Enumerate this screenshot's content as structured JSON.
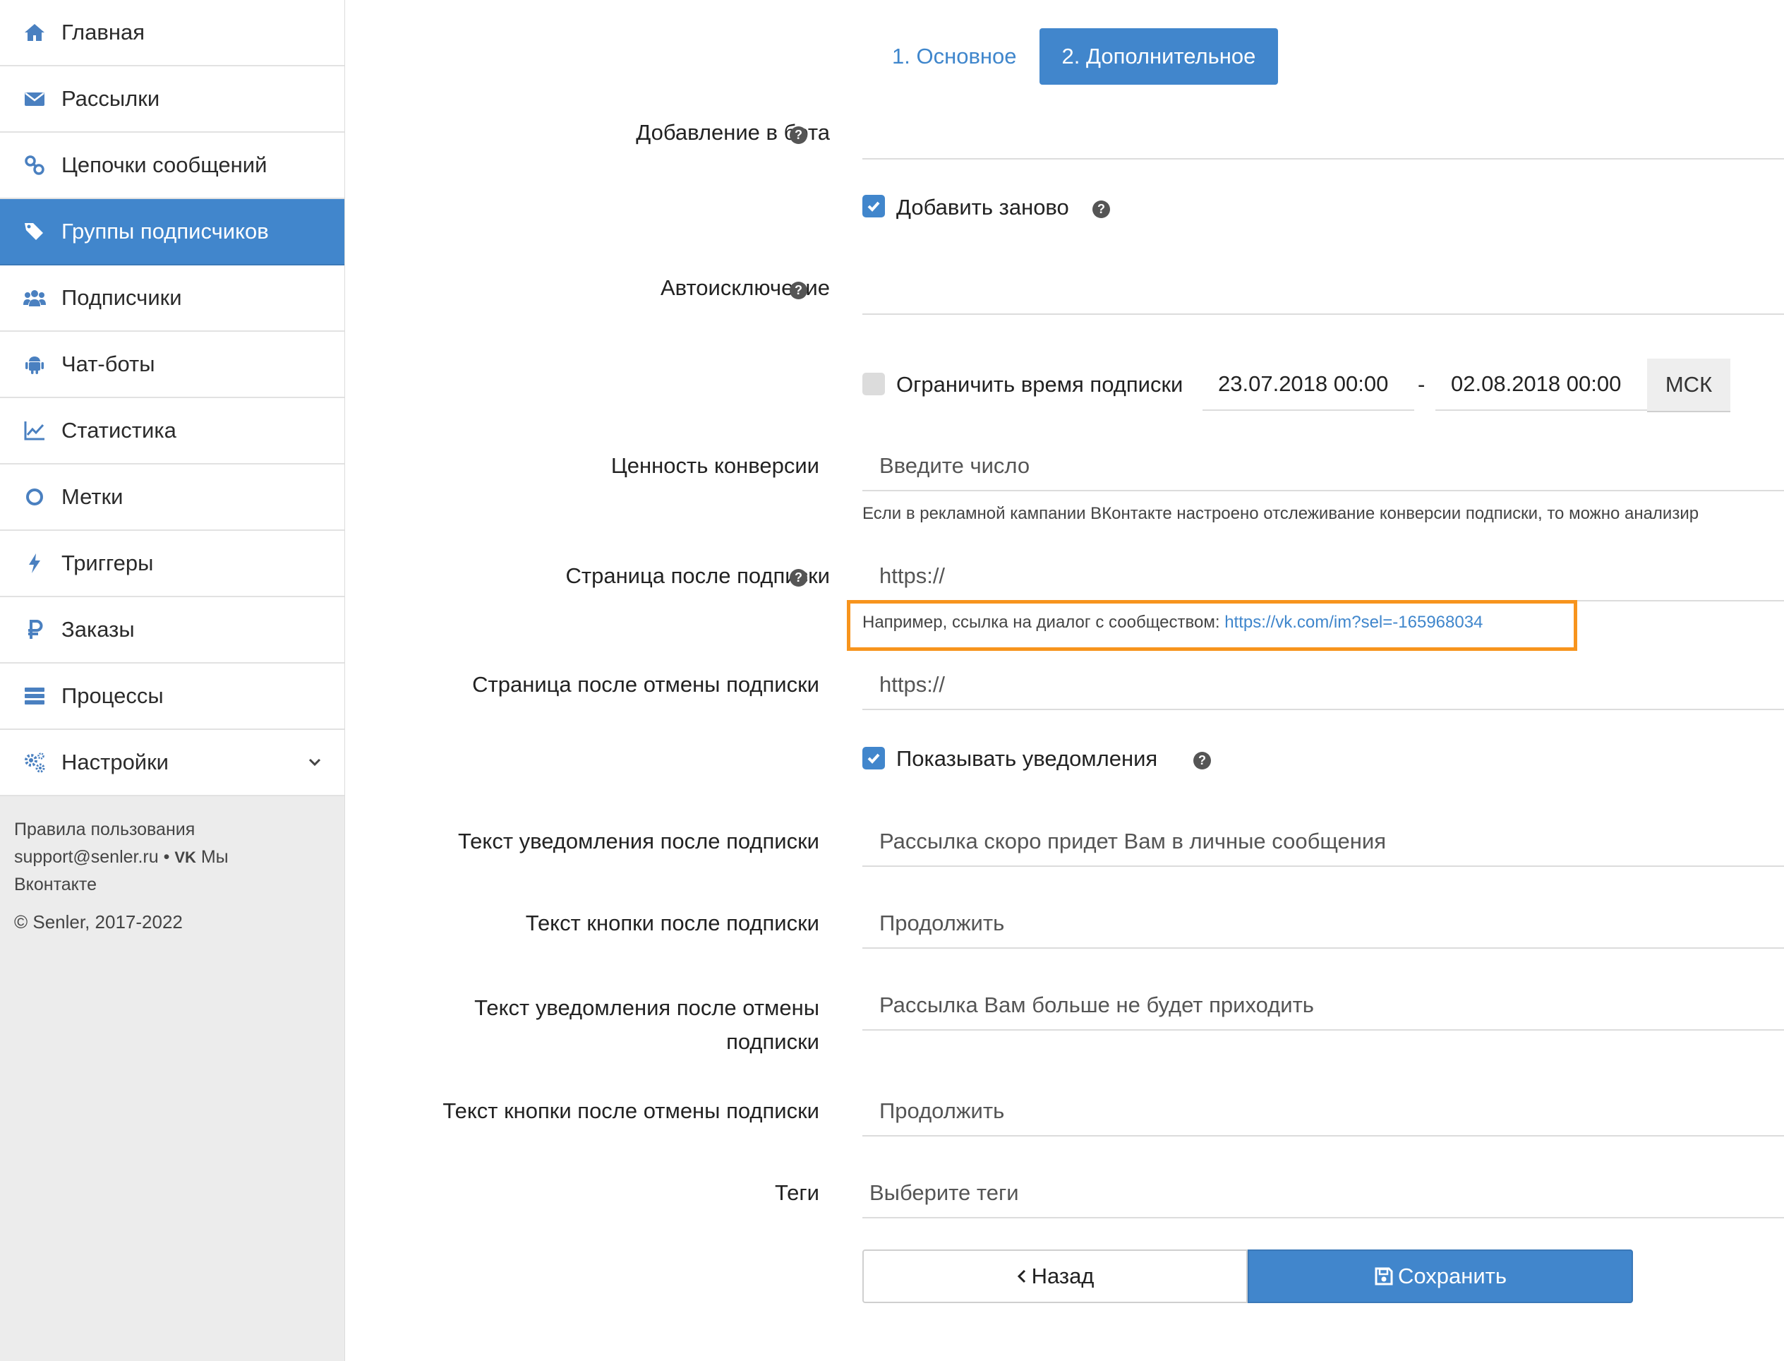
{
  "sidebar": {
    "items": [
      {
        "label": "Главная",
        "icon": "home-icon"
      },
      {
        "label": "Рассылки",
        "icon": "envelope-icon"
      },
      {
        "label": "Цепочки сообщений",
        "icon": "link-icon"
      },
      {
        "label": "Группы подписчиков",
        "icon": "tags-icon",
        "active": true
      },
      {
        "label": "Подписчики",
        "icon": "users-icon"
      },
      {
        "label": "Чат-боты",
        "icon": "android-icon"
      },
      {
        "label": "Статистика",
        "icon": "line-chart-icon"
      },
      {
        "label": "Метки",
        "icon": "circle-icon"
      },
      {
        "label": "Триггеры",
        "icon": "bolt-icon"
      },
      {
        "label": "Заказы",
        "icon": "ruble-icon"
      },
      {
        "label": "Процессы",
        "icon": "server-icon"
      },
      {
        "label": "Настройки",
        "icon": "gears-icon"
      }
    ],
    "footer": {
      "terms": "Правила пользования",
      "support": "support@senler.ru",
      "bullet": "•",
      "vk_logo": "VK",
      "vk_text": "Мы",
      "vk_text2": "Вконтакте",
      "copyright": "© Senler, 2017-2022"
    }
  },
  "tabs": {
    "basic": "1. Основное",
    "extra": "2. Дополнительное"
  },
  "form": {
    "add_to_bot_label": "Добавление в бота",
    "add_again_label": "Добавить заново",
    "auto_exclude_label": "Автоисключение",
    "limit_time_label": "Ограничить время подписки",
    "date_from": "23.07.2018 00:00",
    "date_sep": "-",
    "date_to": "02.08.2018 00:00",
    "timezone": "МСК",
    "conversion_label": "Ценность конверсии",
    "conversion_placeholder": "Введите число",
    "conversion_hint": "Если в рекламной кампании ВКонтакте настроено отслеживание конверсии подписки, то можно анализир",
    "page_after_sub_label": "Страница после подписки",
    "page_after_sub_value": "https://",
    "example_hint": "Например, ссылка на диалог с сообществом:",
    "example_link": "https://vk.com/im?sel=-165968034",
    "page_after_unsub_label": "Страница после отмены подписки",
    "page_after_unsub_value": "https://",
    "show_notifications_label": "Показывать уведомления",
    "notif_after_sub_label": "Текст уведомления после подписки",
    "notif_after_sub_value": "Рассылка скоро придет Вам в личные сообщения",
    "btn_after_sub_label": "Текст кнопки после подписки",
    "btn_after_sub_value": "Продолжить",
    "notif_after_unsub_label_1": "Текст уведомления после отмены",
    "notif_after_unsub_label_2": "подписки",
    "notif_after_unsub_value": "Рассылка Вам больше не будет приходить",
    "btn_after_unsub_label": "Текст кнопки после отмены подписки",
    "btn_after_unsub_value": "Продолжить",
    "tags_label": "Теги",
    "tags_placeholder": "Выберите теги",
    "help_glyph": "?"
  },
  "buttons": {
    "back": "Назад",
    "save": "Сохранить"
  },
  "colors": {
    "accent": "#4186cc",
    "highlight": "#f7941d"
  }
}
